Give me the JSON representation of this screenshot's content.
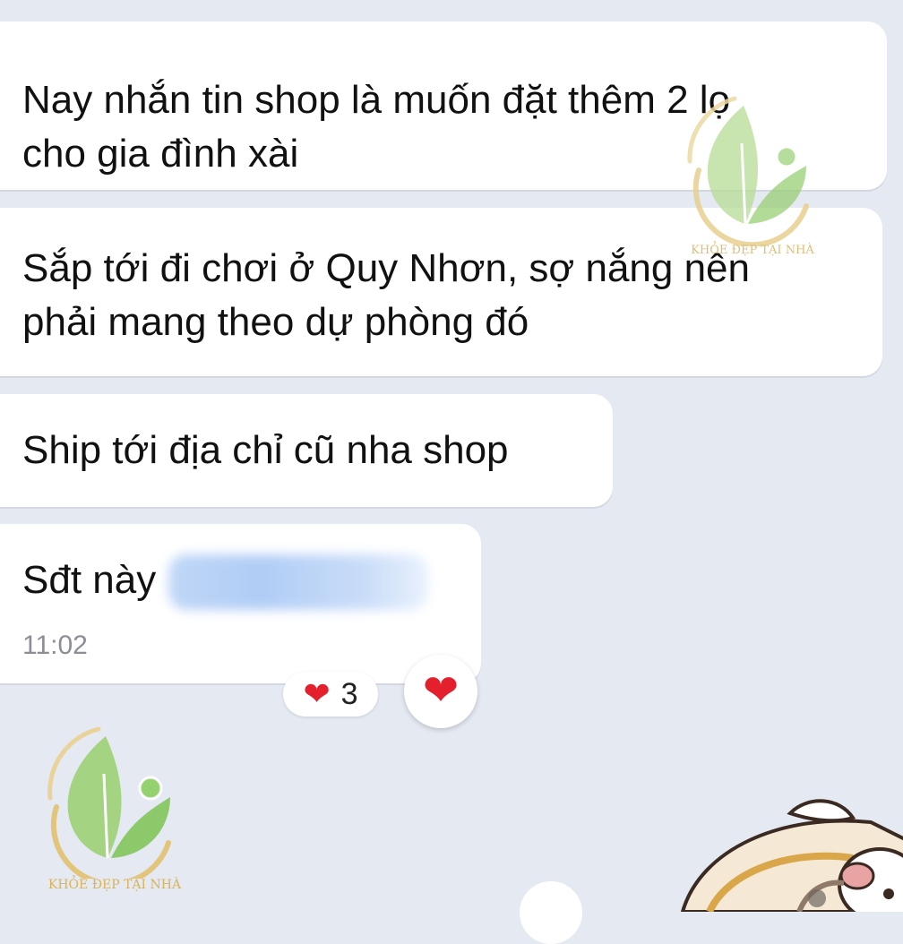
{
  "messages": [
    {
      "lines": [
        "Nay nhắn tin shop là muốn đặt thêm 2 lọ",
        "cho gia đình xài"
      ]
    },
    {
      "lines": [
        "Sắp tới đi chơi ở Quy Nhơn, sợ nắng nên",
        "phải mang theo dự phòng đó"
      ]
    },
    {
      "text": "Ship tới địa chỉ cũ nha shop"
    },
    {
      "text": "Sđt này",
      "time": "11:02"
    }
  ],
  "reactions": {
    "emoji": "❤",
    "count": "3",
    "button_emoji": "❤",
    "color": "#e3202c"
  },
  "watermark": {
    "brand": "KHỎE ĐẸP TẠI NHÀ",
    "colors": {
      "leaf": "#8bc96a",
      "gold": "#d9b35a"
    }
  },
  "theme": {
    "background": "#e5e9f2",
    "bubble": "#ffffff",
    "timestamp": "#8b8e95"
  },
  "icons": [
    "heart-icon",
    "leaf-logo-icon",
    "sticker-icon"
  ]
}
